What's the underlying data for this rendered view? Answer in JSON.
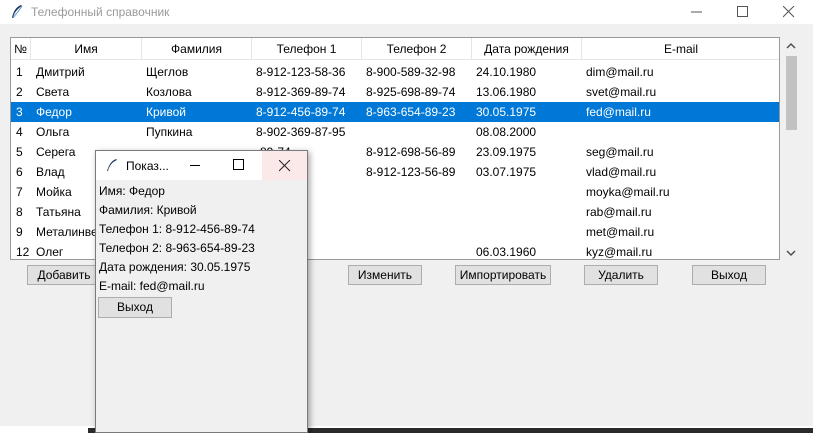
{
  "window": {
    "title": "Телефонный справочник"
  },
  "columns": [
    "№",
    "Имя",
    "Фамилия",
    "Телефон 1",
    "Телефон 2",
    "Дата рождения",
    "E-mail"
  ],
  "rows": [
    [
      "1",
      "Дмитрий",
      "Щеглов",
      "8-912-123-58-36",
      "8-900-589-32-98",
      "24.10.1980",
      "dim@mail.ru"
    ],
    [
      "2",
      "Света",
      "Козлова",
      "8-912-369-89-74",
      "8-925-698-89-74",
      "13.06.1980",
      "svet@mail.ru"
    ],
    [
      "3",
      "Федор",
      "Кривой",
      "8-912-456-89-74",
      "8-963-654-89-23",
      "30.05.1975",
      "fed@mail.ru"
    ],
    [
      "4",
      "Ольга",
      "Пупкина",
      "8-902-369-87-95",
      "",
      "08.08.2000",
      ""
    ],
    [
      "5",
      "Серега",
      "",
      "-89-74",
      "8-912-698-56-89",
      "23.09.1975",
      "seg@mail.ru"
    ],
    [
      "6",
      "Влад",
      "",
      "-23-74",
      "8-912-123-56-89",
      "03.07.1975",
      "vlad@mail.ru"
    ],
    [
      "7",
      "Мойка",
      "",
      "-23-74",
      "",
      "",
      "moyka@mail.ru"
    ],
    [
      "8",
      "Татьяна",
      "",
      "-78-74",
      "",
      "",
      "rab@mail.ru"
    ],
    [
      "9",
      "Металинве",
      "",
      "-78-74",
      "",
      "",
      "met@mail.ru"
    ],
    [
      "12",
      "Олег",
      "",
      "-89-14",
      "",
      "06.03.1960",
      "kyz@mail.ru"
    ]
  ],
  "selected_row": 2,
  "buttons": {
    "add": "Добавить",
    "edit": "Изменить",
    "import": "Импортировать",
    "delete": "Удалить",
    "exit": "Выход"
  },
  "dialog": {
    "title": "Показ...",
    "name_line": "Имя: Федор",
    "surname_line": "Фамилия: Кривой",
    "phone1_line": "Телефон 1: 8-912-456-89-74",
    "phone2_line": "Телефон 2: 8-963-654-89-23",
    "birth_line": "Дата рождения: 30.05.1975",
    "email_line": "E-mail: fed@mail.ru",
    "exit_label": "Выход"
  },
  "colors": {
    "selection": "#0078d7",
    "close_hover": "#fbe9ea"
  },
  "icons": [
    "feather-icon",
    "minimize-icon",
    "maximize-icon",
    "close-icon",
    "scroll-up-icon",
    "scroll-down-icon"
  ]
}
